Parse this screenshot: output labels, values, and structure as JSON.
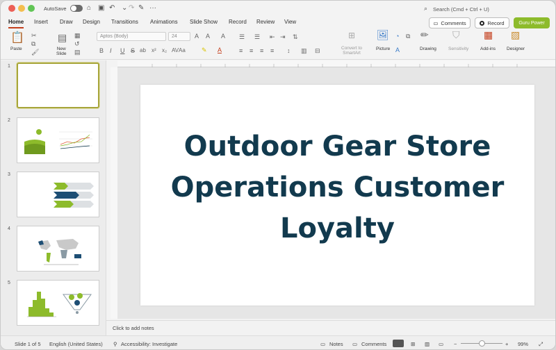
{
  "titlebar": {
    "autosave_label": "AutoSave",
    "search_placeholder": "Search (Cmd + Ctrl + U)"
  },
  "tabs": [
    "Home",
    "Insert",
    "Draw",
    "Design",
    "Transitions",
    "Animations",
    "Slide Show",
    "Record",
    "Review",
    "View"
  ],
  "actions": {
    "comments": "Comments",
    "record": "Record",
    "guru": "Guru Power"
  },
  "ribbon": {
    "paste": "Paste",
    "new_slide_1": "New",
    "new_slide_2": "Slide",
    "font_name": "Aptos (Body)",
    "font_size": "24",
    "convert_1": "Convert to",
    "convert_2": "SmartArt",
    "picture": "Picture",
    "drawing": "Drawing",
    "sensitivity": "Sensitivity",
    "addins": "Add-ins",
    "designer": "Designer",
    "format_buttons": [
      "B",
      "I",
      "U",
      "S",
      "ab",
      "x²",
      "x₂",
      "AV",
      "Aa"
    ]
  },
  "slides": [
    {
      "number": "1"
    },
    {
      "number": "2"
    },
    {
      "number": "3"
    },
    {
      "number": "4"
    },
    {
      "number": "5"
    }
  ],
  "slide": {
    "title_line1": "Outdoor Gear Store",
    "title_line2": "Operations Customer",
    "title_line3": "Loyalty"
  },
  "notes_placeholder": "Click to add notes",
  "status": {
    "slide_info": "Slide 1 of 5",
    "language": "English (United States)",
    "accessibility": "Accessibility: Investigate",
    "notes": "Notes",
    "comments": "Comments",
    "zoom": "99%"
  },
  "colors": {
    "accent": "#c43e1c",
    "title": "#123a4e",
    "selection": "#a7a53a",
    "guru": "#8dbb2b"
  }
}
